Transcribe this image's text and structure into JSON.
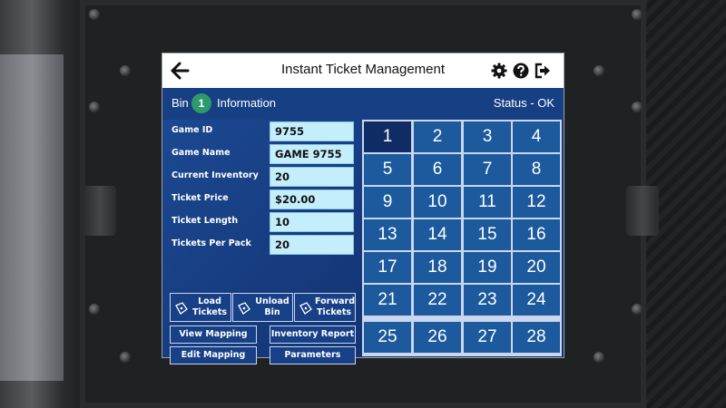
{
  "titlebar": {
    "title": "Instant Ticket Management"
  },
  "icons": {
    "back": "arrow-left-icon",
    "settings": "gear-icon",
    "help": "question-icon",
    "logout": "logout-icon"
  },
  "infobar": {
    "bin_label": "Bin",
    "bin_number": "1",
    "info_label": "Information",
    "status": "Status - OK"
  },
  "fields": [
    {
      "label": "Game ID",
      "value": "9755"
    },
    {
      "label": "Game Name",
      "value": "GAME 9755"
    },
    {
      "label": "Current Inventory",
      "value": "20"
    },
    {
      "label": "Ticket Price",
      "value": "$20.00"
    },
    {
      "label": "Ticket Length",
      "value": "10"
    },
    {
      "label": "Tickets Per Pack",
      "value": "20"
    }
  ],
  "actions": {
    "load_tickets": "Load Tickets",
    "unload_bin": "Unload Bin",
    "forward_tickets": "Forward Tickets",
    "view_mapping": "View Mapping",
    "inventory_report": "Inventory Report",
    "edit_mapping": "Edit Mapping",
    "parameters": "Parameters"
  },
  "bins": [
    "1",
    "2",
    "3",
    "4",
    "5",
    "6",
    "7",
    "8",
    "9",
    "10",
    "11",
    "12",
    "13",
    "14",
    "15",
    "16",
    "17",
    "18",
    "19",
    "20",
    "21",
    "22",
    "23",
    "24",
    "25",
    "26",
    "27",
    "28"
  ],
  "selected_bin": "1",
  "colors": {
    "accent": "#174087",
    "badge": "#2e9a6b",
    "field_bg": "#c4eefb",
    "selected": "#102c64"
  }
}
